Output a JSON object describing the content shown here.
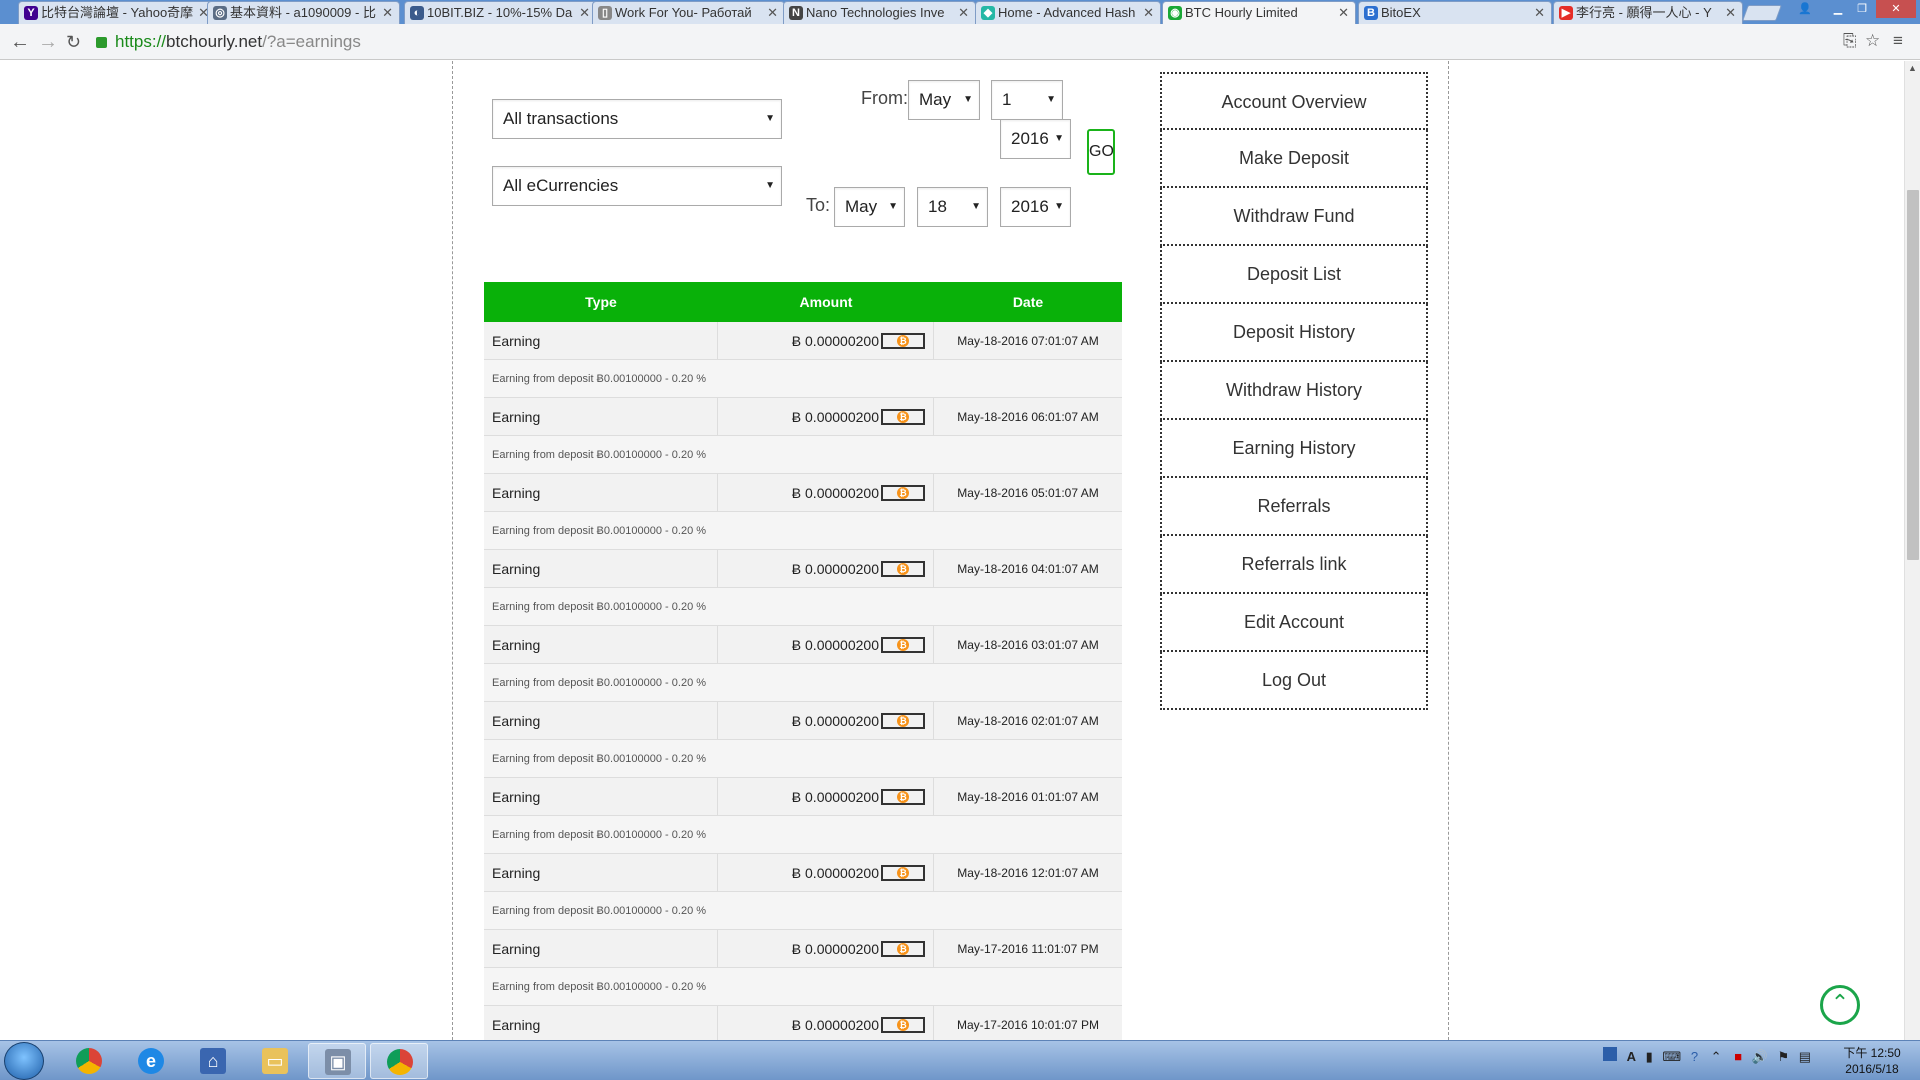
{
  "browser": {
    "tabs": [
      {
        "label": "比特台灣論壇 - Yahoo奇摩",
        "icon": "Y",
        "color": "#400090"
      },
      {
        "label": "基本資料 - a1090009 - 比",
        "icon": "◎",
        "color": "#5b6d85"
      },
      {
        "label": "10BIT.BIZ - 10%-15% Da",
        "icon": "◐",
        "color": "#3b5b8c"
      },
      {
        "label": "Work For You- Работай",
        "icon": "▯",
        "color": "#888888"
      },
      {
        "label": "Nano Technologies Inve",
        "icon": "N",
        "color": "#444444"
      },
      {
        "label": "Home - Advanced Hash",
        "icon": "◆",
        "color": "#25b8a6"
      },
      {
        "label": "BTC Hourly Limited",
        "icon": "◉",
        "color": "#1aa836"
      },
      {
        "label": "BitoEX",
        "icon": "B",
        "color": "#2c6fd0"
      },
      {
        "label": "李行亮 - 願得一人心 - Y",
        "icon": "▶",
        "color": "#e52d27"
      }
    ],
    "active_tab": 6,
    "url": {
      "scheme": "https://",
      "host": "btchourly.net",
      "path": "/?a=earnings"
    }
  },
  "filters": {
    "type_select": "All transactions",
    "currency_select": "All eCurrencies",
    "from_label": "From:",
    "to_label": "To:",
    "from_month": "May",
    "from_day": "1",
    "from_year": "2016",
    "to_month": "May",
    "to_day": "18",
    "to_year": "2016",
    "go_label": "GO"
  },
  "table": {
    "headers": [
      "Type",
      "Amount",
      "Date"
    ],
    "currency_symbol": "Ƀ",
    "rows": [
      {
        "type": "Earning",
        "amount": "Ƀ 0.00000200",
        "date": "May-18-2016 07:01:07 AM",
        "desc": "Earning from deposit Ƀ0.00100000 - 0.20 %"
      },
      {
        "type": "Earning",
        "amount": "Ƀ 0.00000200",
        "date": "May-18-2016 06:01:07 AM",
        "desc": "Earning from deposit Ƀ0.00100000 - 0.20 %"
      },
      {
        "type": "Earning",
        "amount": "Ƀ 0.00000200",
        "date": "May-18-2016 05:01:07 AM",
        "desc": "Earning from deposit Ƀ0.00100000 - 0.20 %"
      },
      {
        "type": "Earning",
        "amount": "Ƀ 0.00000200",
        "date": "May-18-2016 04:01:07 AM",
        "desc": "Earning from deposit Ƀ0.00100000 - 0.20 %"
      },
      {
        "type": "Earning",
        "amount": "Ƀ 0.00000200",
        "date": "May-18-2016 03:01:07 AM",
        "desc": "Earning from deposit Ƀ0.00100000 - 0.20 %"
      },
      {
        "type": "Earning",
        "amount": "Ƀ 0.00000200",
        "date": "May-18-2016 02:01:07 AM",
        "desc": "Earning from deposit Ƀ0.00100000 - 0.20 %"
      },
      {
        "type": "Earning",
        "amount": "Ƀ 0.00000200",
        "date": "May-18-2016 01:01:07 AM",
        "desc": "Earning from deposit Ƀ0.00100000 - 0.20 %"
      },
      {
        "type": "Earning",
        "amount": "Ƀ 0.00000200",
        "date": "May-18-2016 12:01:07 AM",
        "desc": "Earning from deposit Ƀ0.00100000 - 0.20 %"
      },
      {
        "type": "Earning",
        "amount": "Ƀ 0.00000200",
        "date": "May-17-2016 11:01:07 PM",
        "desc": "Earning from deposit Ƀ0.00100000 - 0.20 %"
      },
      {
        "type": "Earning",
        "amount": "Ƀ 0.00000200",
        "date": "May-17-2016 10:01:07 PM",
        "desc": ""
      }
    ]
  },
  "sidebar": {
    "items": [
      "Account Overview",
      "Make Deposit",
      "Withdraw Fund",
      "Deposit List",
      "Deposit History",
      "Withdraw History",
      "Earning History",
      "Referrals",
      "Referrals link",
      "Edit Account",
      "Log Out"
    ]
  },
  "taskbar": {
    "clock_time": "下午 12:50",
    "clock_date": "2016/5/18"
  },
  "colors": {
    "accent_green": "#09b109",
    "tab_bar": "#5b8fd0",
    "bitcoin_orange": "#f7931a"
  }
}
